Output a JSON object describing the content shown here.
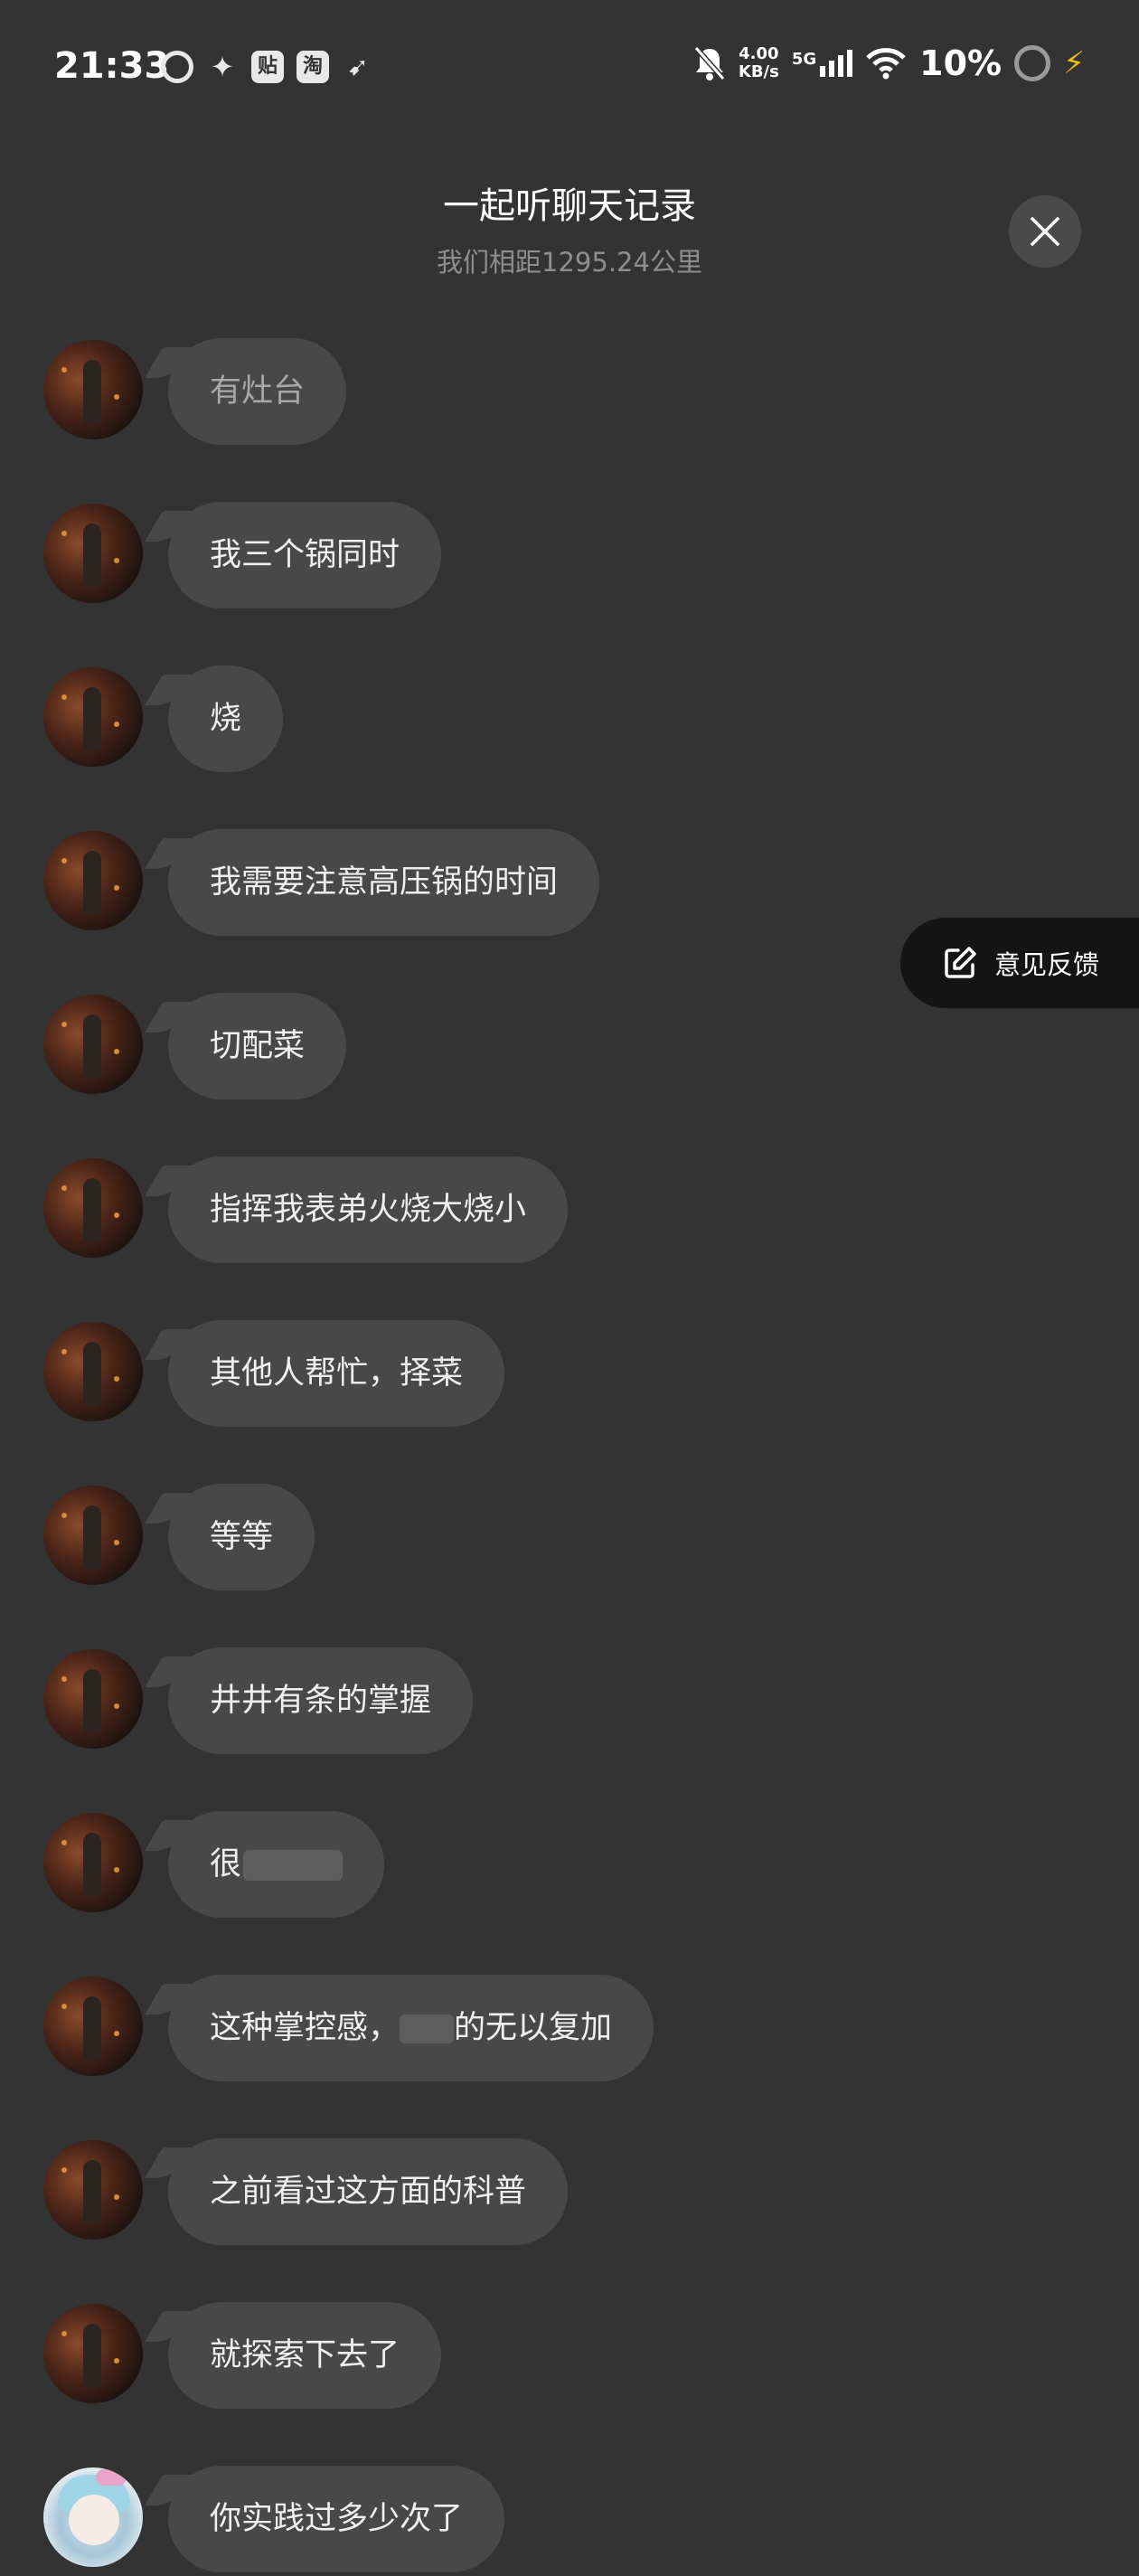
{
  "status_bar": {
    "time": "21:33",
    "apps": [
      "贴",
      "淘"
    ],
    "net_speed_value": "4.00",
    "net_speed_unit": "KB/s",
    "network": "5G",
    "battery": "10%"
  },
  "header": {
    "title": "一起听聊天记录",
    "subtitle": "我们相距1295.24公里"
  },
  "feedback": {
    "label": "意见反馈"
  },
  "messages": [
    {
      "text": "有灶台"
    },
    {
      "text": "我三个锅同时"
    },
    {
      "text": "烧"
    },
    {
      "text": "我需要注意高压锅的时间"
    },
    {
      "text": "切配菜"
    },
    {
      "text": "指挥我表弟火烧大烧小"
    },
    {
      "text": "其他人帮忙，择菜"
    },
    {
      "text": "等等"
    },
    {
      "text": "井井有条的掌握"
    },
    {
      "text_visible": "很"
    },
    {
      "text_before": "这种掌控感，",
      "text_after": "的无以复加"
    },
    {
      "text": "之前看过这方面的科普"
    },
    {
      "text": "就探索下去了"
    },
    {
      "text": "你实践过多少次了"
    }
  ]
}
